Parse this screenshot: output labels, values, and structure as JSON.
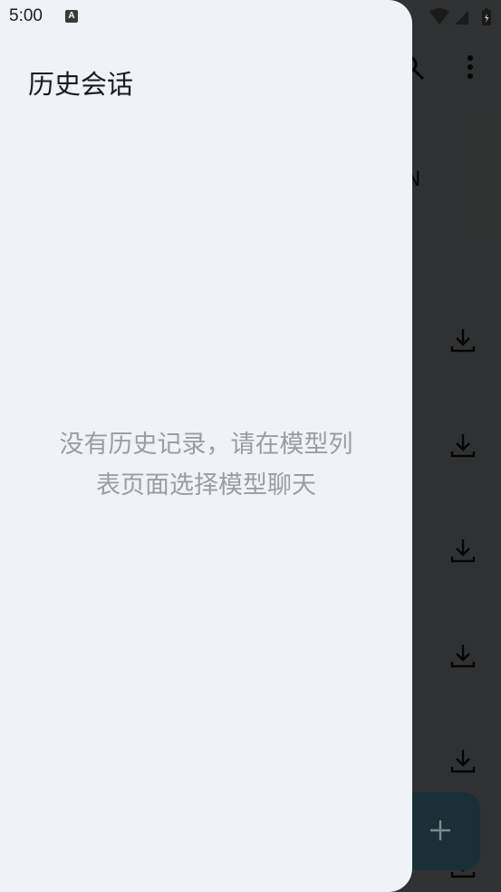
{
  "status_bar": {
    "time": "5:00",
    "notification_icon_letter": "A"
  },
  "drawer": {
    "title": "历史会话",
    "empty_message_line1": "没有历史记录，请在模型列",
    "empty_message_line2": "表页面选择模型聊天"
  },
  "background": {
    "partial_letter": "N",
    "download_icon_count": 6
  },
  "colors": {
    "drawer_bg": "#eff3f8",
    "scrim": "#000000",
    "fab_bg": "#1a2f36",
    "empty_text": "#9a9da1"
  }
}
